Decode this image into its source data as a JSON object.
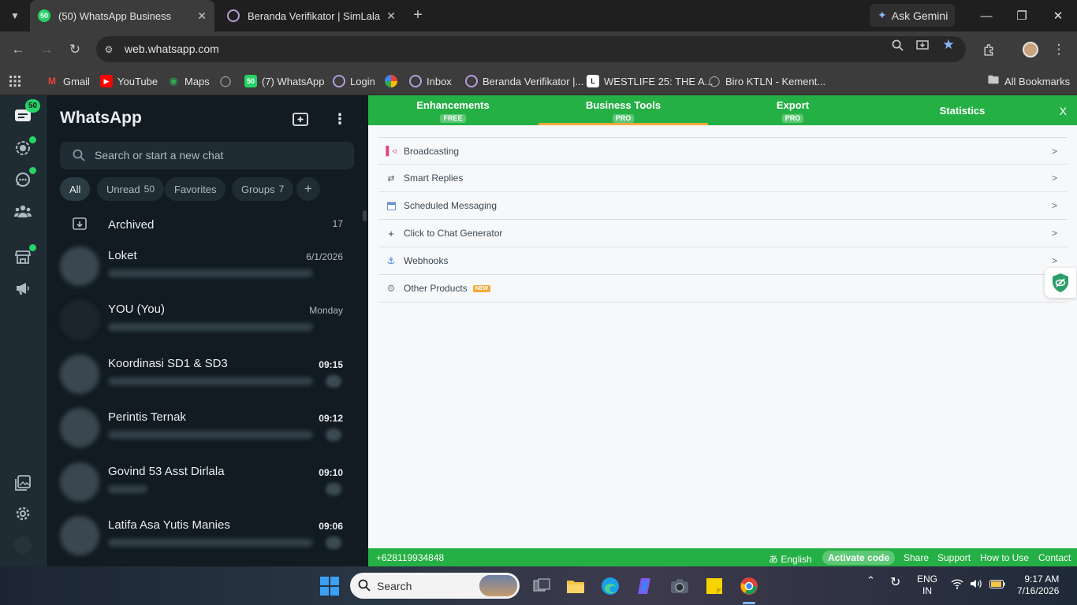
{
  "browser": {
    "tabs": [
      {
        "title": "(50) WhatsApp Business",
        "favicon": "50"
      },
      {
        "title": "Beranda Verifikator | SimLala"
      }
    ],
    "gemini_label": "Ask Gemini",
    "url": "web.whatsapp.com",
    "bookmarks": [
      {
        "label": "Gmail",
        "color": "#ea4335"
      },
      {
        "label": "YouTube",
        "color": "#ff0000"
      },
      {
        "label": "Maps",
        "color": "#34a853"
      },
      {
        "label": "",
        "color": "#888888"
      },
      {
        "label": "(7) WhatsApp",
        "color": "#25d366",
        "badge": "50"
      },
      {
        "label": "Login",
        "color": "#9c27b0"
      },
      {
        "label": "",
        "color": "#fbbc04"
      },
      {
        "label": "Inbox",
        "color": "#9c27b0"
      },
      {
        "label": "Beranda Verifikator |...",
        "color": "#9c27b0"
      },
      {
        "label": "WESTLIFE 25: THE A...",
        "color": "#ffffff"
      },
      {
        "label": "Biro KTLN - Kement...",
        "color": "#888888"
      }
    ],
    "all_bookmarks": "All Bookmarks"
  },
  "whatsapp": {
    "title": "WhatsApp",
    "rail_badge": "50",
    "search_placeholder": "Search or start a new chat",
    "filters": [
      {
        "label": "All"
      },
      {
        "label": "Unread",
        "count": "50"
      },
      {
        "label": "Favorites"
      },
      {
        "label": "Groups",
        "count": "7"
      }
    ],
    "add_filter": "+",
    "archived": {
      "label": "Archived",
      "count": "17"
    },
    "chats": [
      {
        "name": "Loket",
        "time": "6/1/2026",
        "bold": false
      },
      {
        "name": "YOU (You)",
        "time": "Monday",
        "bold": false
      },
      {
        "name": "Koordinasi SD1 & SD3",
        "time": "09:15",
        "bold": true
      },
      {
        "name": "Perintis Ternak",
        "time": "09:12",
        "bold": true
      },
      {
        "name": "Govind 53 Asst Dirlala",
        "time": "09:10",
        "bold": true
      },
      {
        "name": "Latifa Asa Yutis Manies",
        "time": "09:06",
        "bold": true
      }
    ]
  },
  "extension": {
    "tabs": [
      {
        "label": "Enhancements",
        "badge": "FREE"
      },
      {
        "label": "Business Tools",
        "badge": "PRO",
        "active": true
      },
      {
        "label": "Export",
        "badge": "PRO"
      },
      {
        "label": "Statistics"
      }
    ],
    "close_label": "X",
    "items": [
      {
        "label": "Broadcasting",
        "icon": "megaphone-icon"
      },
      {
        "label": "Smart Replies",
        "icon": "arrows-icon"
      },
      {
        "label": "Scheduled Messaging",
        "icon": "calendar-icon"
      },
      {
        "label": "Click to Chat Generator",
        "icon": "plus-icon"
      },
      {
        "label": "Webhooks",
        "icon": "anchor-icon"
      },
      {
        "label": "Other Products",
        "icon": "gear-icon",
        "badge": "NEW"
      }
    ],
    "arrow": ">",
    "footer": {
      "phone": "+628119934848",
      "language": "English",
      "activate": "Activate code",
      "share": "Share",
      "support": "Support",
      "how_to_use": "How to Use",
      "contact": "Contact"
    }
  },
  "taskbar": {
    "search_label": "Search",
    "lang_line1": "ENG",
    "lang_line2": "IN",
    "time": "9:17 AM",
    "date": "7/16/2026"
  }
}
